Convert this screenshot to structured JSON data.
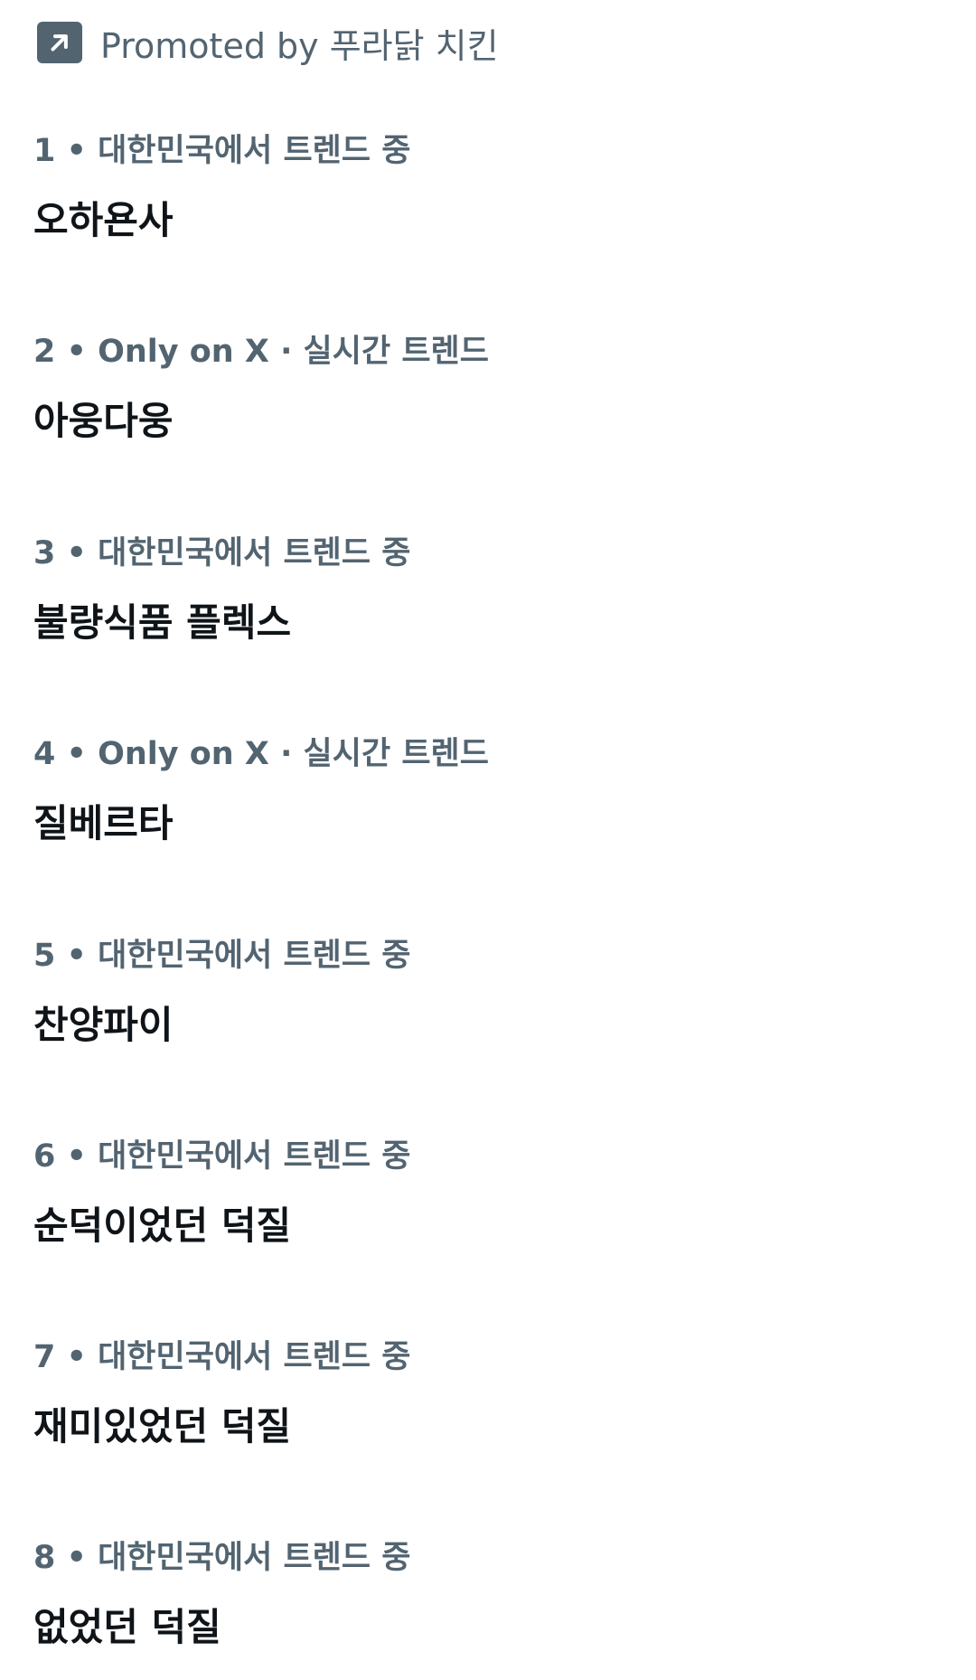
{
  "promoted": {
    "icon": "arrow-up-right-icon",
    "text": "Promoted by 푸라닭 치킨"
  },
  "trends": [
    {
      "meta": "1 • 대한민국에서 트렌드 중",
      "title": "오하욘사"
    },
    {
      "meta": "2 • Only on X · 실시간 트렌드",
      "title": "아웅다웅"
    },
    {
      "meta": "3 • 대한민국에서 트렌드 중",
      "title": "불량식품 플렉스"
    },
    {
      "meta": "4 • Only on X · 실시간 트렌드",
      "title": "질베르타"
    },
    {
      "meta": "5 • 대한민국에서 트렌드 중",
      "title": "찬양파이"
    },
    {
      "meta": "6 • 대한민국에서 트렌드 중",
      "title": "순덕이었던 덕질"
    },
    {
      "meta": "7 • 대한민국에서 트렌드 중",
      "title": "재미있었던 덕질"
    },
    {
      "meta": "8 • 대한민국에서 트렌드 중",
      "title": "없었던 덕질"
    }
  ]
}
